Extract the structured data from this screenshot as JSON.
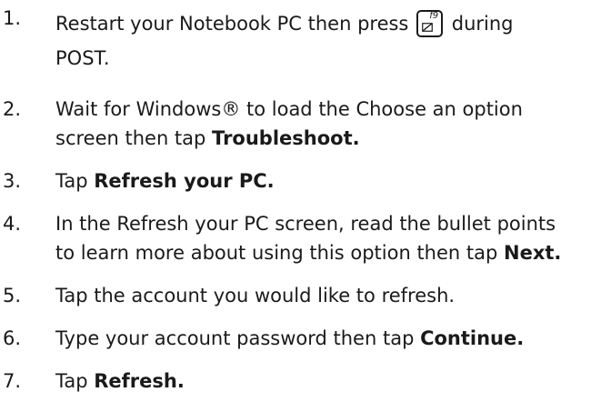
{
  "steps": [
    {
      "num": "1.",
      "part1": "Restart your Notebook PC then press",
      "key_label": "f9",
      "part2": "during",
      "line2": "POST."
    },
    {
      "num": "2.",
      "line1": "Wait for Windows® to load the Choose an option",
      "line2_plain": "screen then tap ",
      "line2_bold": "Troubleshoot."
    },
    {
      "num": "3.",
      "plain": "Tap ",
      "bold": "Refresh your PC."
    },
    {
      "num": "4.",
      "line1": "In the Refresh your PC screen, read the bullet points",
      "line2_plain": "to learn more about using this option then tap ",
      "line2_bold": "Next."
    },
    {
      "num": "5.",
      "text": "Tap the account you would like to refresh."
    },
    {
      "num": "6.",
      "plain": "Type your account password then tap ",
      "bold": "Continue."
    },
    {
      "num": "7.",
      "plain": "Tap ",
      "bold": "Refresh."
    }
  ],
  "key_icon": "f9-function-key-icon"
}
